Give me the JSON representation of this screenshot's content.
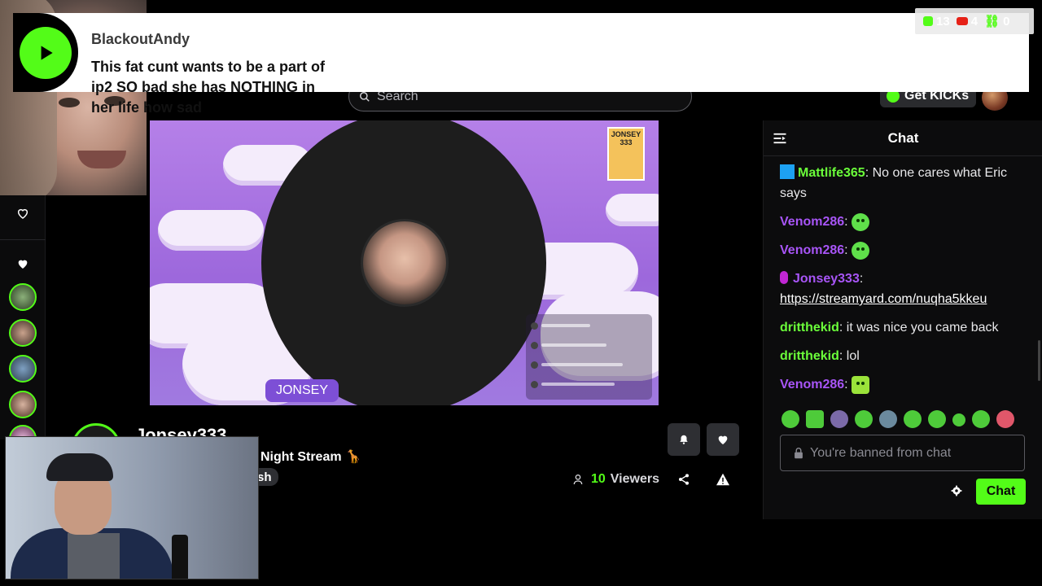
{
  "notification": {
    "username": "BlackoutAndy",
    "message": "This fat cunt wants to be a part of ip2 SO bad she has NOTHING in her life how sad"
  },
  "overlay_stats": {
    "kick_count": "13",
    "youtube_count": "4",
    "link_count": "0"
  },
  "header": {
    "search_placeholder": "Search",
    "get_kicks_label": "Get KICKs"
  },
  "video": {
    "name_card": "JONSEY",
    "sticker_text": "JONSEY 333"
  },
  "stream": {
    "channel_name": "Jonsey333",
    "title": "Night Stream 🦒",
    "tag": "sh",
    "viewers_count": "10",
    "viewers_label": "Viewers"
  },
  "chat": {
    "title": "Chat",
    "messages": [
      {
        "user": "Mattlife365",
        "text": "No one cares what Eric says"
      },
      {
        "user": "Venom286",
        "text": ""
      },
      {
        "user": "Venom286",
        "text": ""
      },
      {
        "user": "Jonsey333",
        "text": "https://streamyard.com/nuqha5kkeu"
      },
      {
        "user": "dritthekid",
        "text": "it was nice you came back"
      },
      {
        "user": "dritthekid",
        "text": "lol"
      },
      {
        "user": "Venom286",
        "text": ""
      }
    ],
    "input_placeholder": "You're banned from chat",
    "send_label": "Chat"
  },
  "colors": {
    "kick_green": "#53fc18",
    "purple_user": "#a855f7",
    "green_user": "#6bff3a"
  }
}
